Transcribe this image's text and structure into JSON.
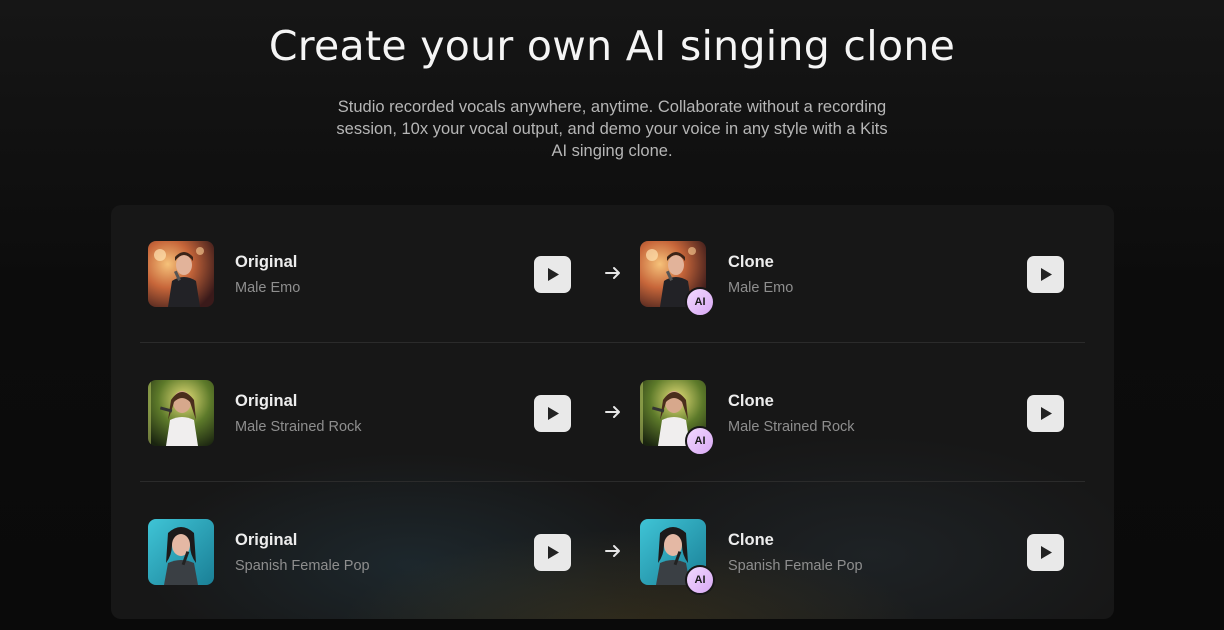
{
  "header": {
    "title": "Create your own AI singing clone",
    "subtitle": "Studio recorded vocals anywhere, anytime. Collaborate without a recording session, 10x your vocal output, and demo your voice in any style with a Kits AI singing clone."
  },
  "comparisons": [
    {
      "original_label": "Original",
      "original_style": "Male Emo",
      "clone_label": "Clone",
      "clone_style": "Male Emo",
      "badge": "AI"
    },
    {
      "original_label": "Original",
      "original_style": "Male Strained Rock",
      "clone_label": "Clone",
      "clone_style": "Male Strained Rock",
      "badge": "AI"
    },
    {
      "original_label": "Original",
      "original_style": "Spanish Female Pop",
      "clone_label": "Clone",
      "clone_style": "Spanish Female Pop",
      "badge": "AI"
    }
  ],
  "icons": {
    "play": "play-icon",
    "arrow": "arrow-right-icon"
  },
  "colors": {
    "background": "#0b0b0b",
    "card": "#171717",
    "play_button": "#e9e9e9",
    "ai_badge": "#d8a8f4"
  }
}
